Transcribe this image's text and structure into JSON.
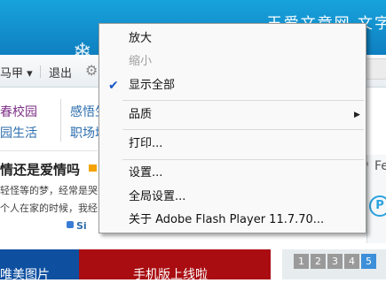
{
  "background": {
    "banner_title": "玉爱文章网 文字",
    "nav": {
      "user": "马甲 ▾",
      "logout": "退出"
    },
    "links": [
      {
        "text": "春校园",
        "color": "purple"
      },
      {
        "text": "园生活",
        "color": "blue"
      },
      {
        "text": "感悟生",
        "color": "blue"
      },
      {
        "text": "职场培",
        "color": "blue"
      }
    ],
    "headline": "情还是爱情吗",
    "excerpt_line1": "轻怪等的梦，经常是哭",
    "excerpt_line2": "个人在家的时候，我经",
    "share_label": "Si",
    "right_partial": "Fe",
    "bottom_left_label": "唯美图片",
    "bottom_mid_label": "手机版上线啦",
    "pager": [
      "1",
      "2",
      "3",
      "4",
      "5"
    ],
    "pager_active": "5"
  },
  "context_menu": {
    "items": {
      "zoom_in": "放大",
      "zoom_out": "缩小",
      "show_all": "显示全部",
      "quality": "品质",
      "print": "打印...",
      "settings": "设置...",
      "global_settings": "全局设置...",
      "about": "关于 Adobe Flash Player 11.7.70..."
    },
    "show_all_checked": true,
    "zoom_out_disabled": true
  }
}
